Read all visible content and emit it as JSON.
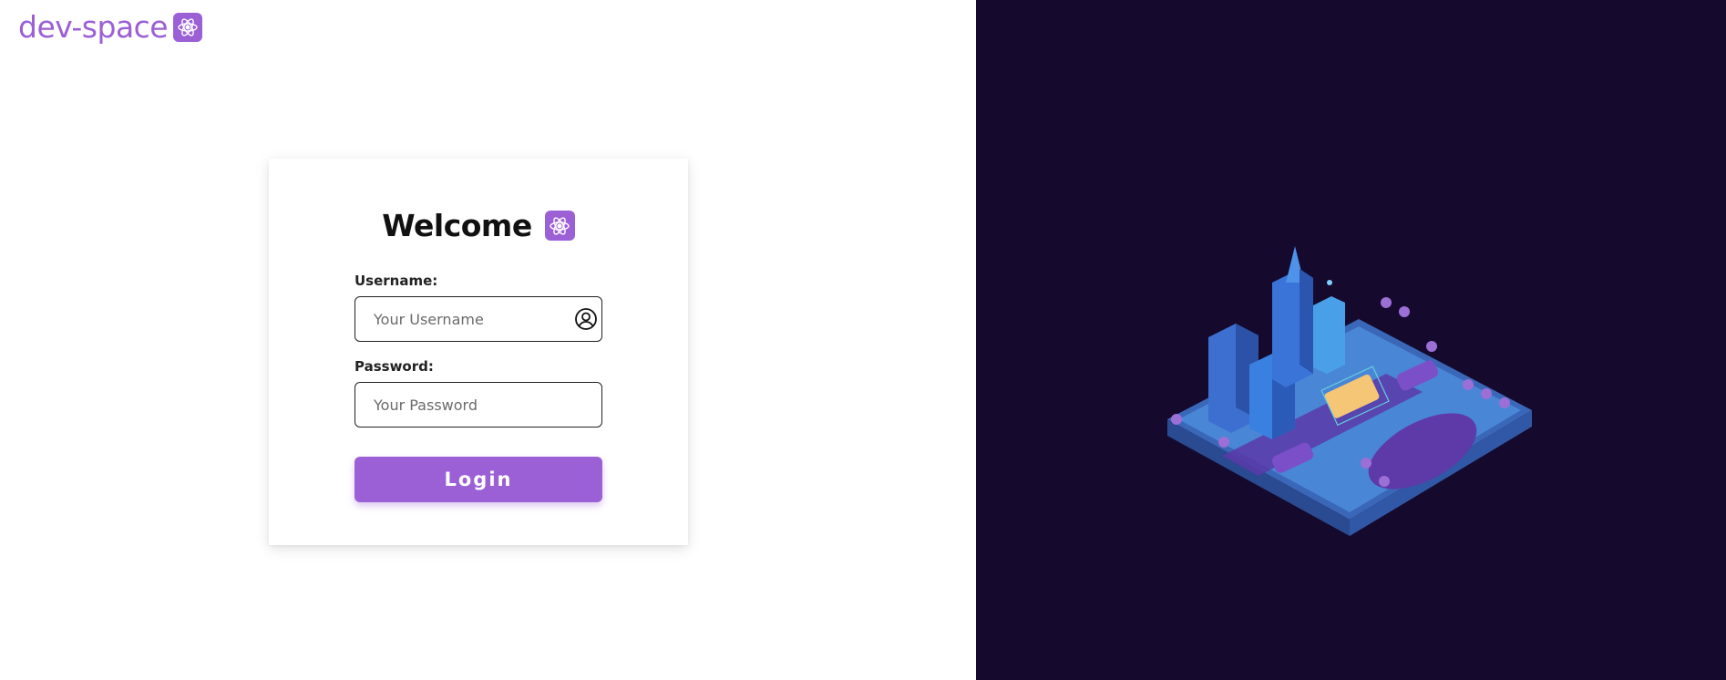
{
  "brand": {
    "name": "dev-space"
  },
  "login_card": {
    "title": "Welcome",
    "username": {
      "label": "Username:",
      "placeholder": "Your Username",
      "value": ""
    },
    "password": {
      "label": "Password:",
      "placeholder": "Your Password",
      "value": ""
    },
    "submit_label": "Login"
  },
  "icons": {
    "brand_icon": "atom-icon",
    "title_icon": "atom-icon",
    "username_icon": "user-circle-icon"
  },
  "colors": {
    "accent": "#9b5fd6",
    "right_panel_bg": "#150a2e",
    "page_bg": "#ffffff"
  }
}
